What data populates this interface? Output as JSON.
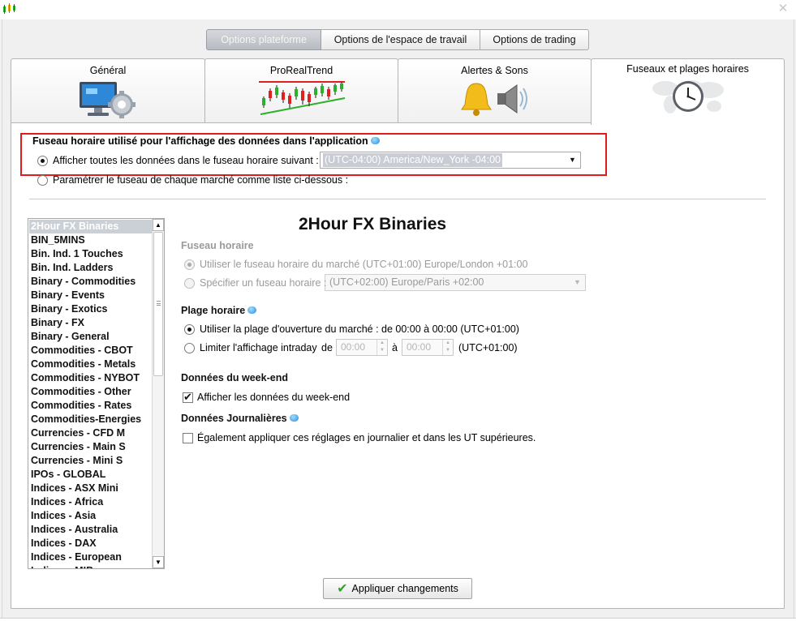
{
  "top_segments": {
    "platform": "Options plateforme",
    "workspace": "Options de l'espace de travail",
    "trading": "Options de trading"
  },
  "tabs": {
    "general": "Général",
    "prorealtrend": "ProRealTrend",
    "alerts": "Alertes & Sons",
    "timezones": "Fuseaux et plages horaires"
  },
  "timezone": {
    "title": "Fuseau horaire utilisé pour l'affichage des données dans l'application",
    "option_all_label": "Afficher toutes les données dans le fuseau horaire suivant :",
    "selected_timezone": "(UTC-04:00) America/New_York -04:00",
    "option_per_market_label": "Paramétrer le fuseau de chaque marché comme liste ci-dessous :"
  },
  "markets": {
    "items": [
      "2Hour FX Binaries",
      "BIN_5MINS",
      "Bin. Ind. 1 Touches",
      "Bin. Ind. Ladders",
      "Binary - Commodities",
      "Binary - Events",
      "Binary - Exotics",
      "Binary - FX",
      "Binary - General",
      "Commodities - CBOT",
      "Commodities - Metals",
      "Commodities - NYBOT",
      "Commodities - Other",
      "Commodities - Rates",
      "Commodities-Energies",
      "Currencies - CFD M",
      "Currencies - Main S",
      "Currencies - Mini S",
      "IPOs - GLOBAL",
      "Indices - ASX Mini",
      "Indices - Africa",
      "Indices - Asia",
      "Indices - Australia",
      "Indices - DAX",
      "Indices - European",
      "Indices - MIB"
    ]
  },
  "detail": {
    "market_title": "2Hour FX Binaries",
    "tz_section": "Fuseau horaire",
    "use_market_tz": "Utiliser le fuseau horaire du marché (UTC+01:00) Europe/London +01:00",
    "specify_tz": "Spécifier un fuseau horaire :",
    "specify_tz_value": "(UTC+02:00) Europe/Paris +02:00",
    "hours_section": "Plage horaire",
    "use_opening_hours": "Utiliser la plage d'ouverture du marché : de 00:00 à 00:00  (UTC+01:00)",
    "limit_intraday": "Limiter l'affichage intraday",
    "de": "de",
    "a": "à",
    "time_from": "00:00",
    "time_to": "00:00",
    "limit_tz": "(UTC+01:00)",
    "weekend_section": "Données du week-end",
    "show_weekend": "Afficher les données du week-end",
    "daily_section": "Données Journalières",
    "apply_daily": "Également appliquer ces réglages en journalier et dans les UT supérieures."
  },
  "apply_button": "Appliquer changements",
  "close_glyph": "✕"
}
